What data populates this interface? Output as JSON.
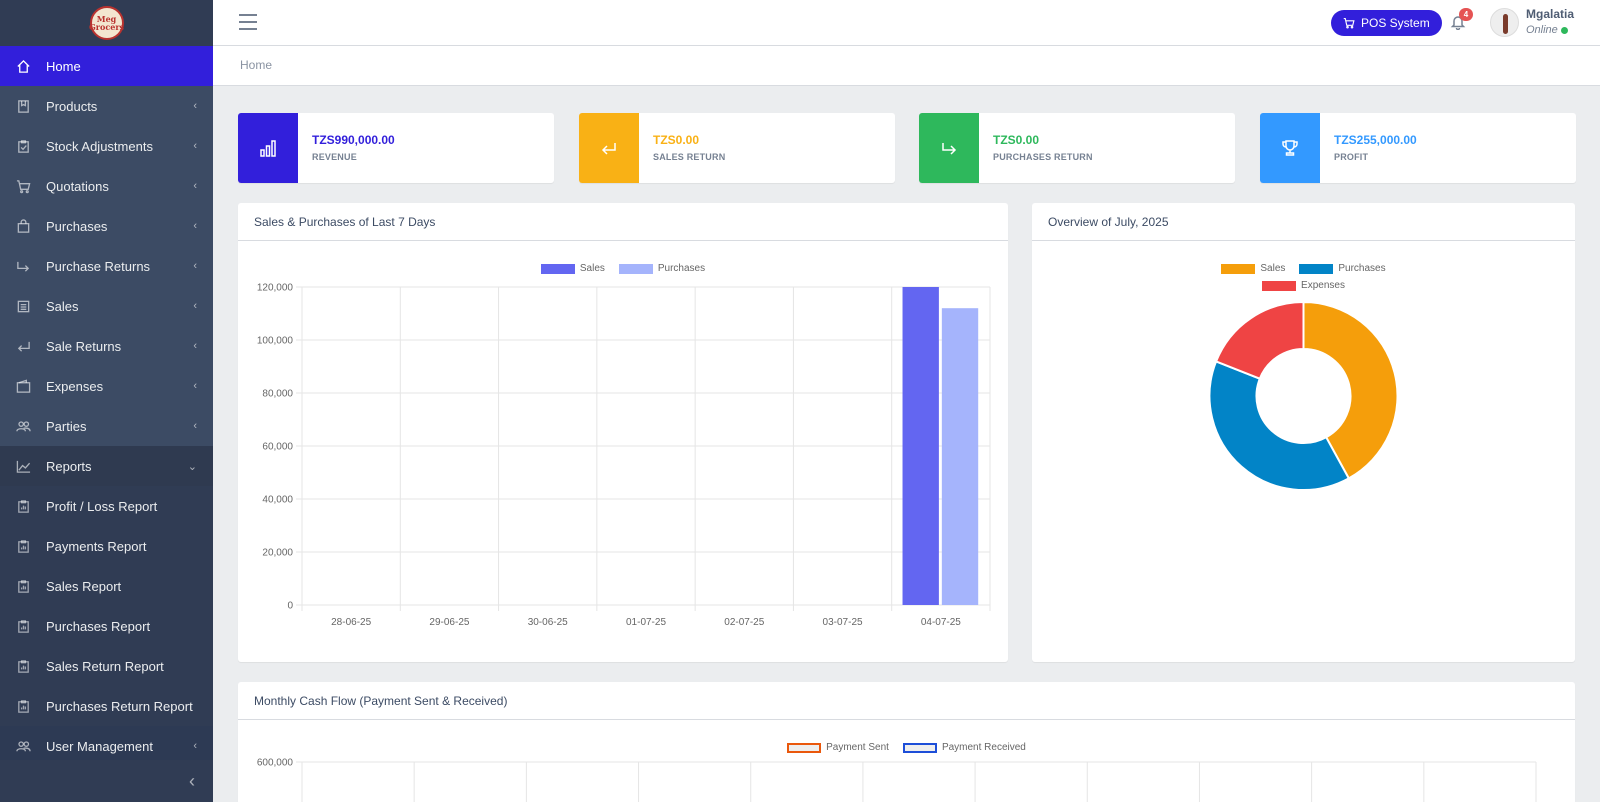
{
  "sidebar": {
    "logo_text": "Meg Grocers",
    "items": [
      {
        "label": "Home",
        "icon": "home-icon"
      },
      {
        "label": "Products",
        "icon": "products-icon"
      },
      {
        "label": "Stock Adjustments",
        "icon": "clipboard-check-icon"
      },
      {
        "label": "Quotations",
        "icon": "cart-icon"
      },
      {
        "label": "Purchases",
        "icon": "bag-icon"
      },
      {
        "label": "Purchase Returns",
        "icon": "arrow-return-right-icon"
      },
      {
        "label": "Sales",
        "icon": "list-icon"
      },
      {
        "label": "Sale Returns",
        "icon": "arrow-return-left-icon"
      },
      {
        "label": "Expenses",
        "icon": "wallet-icon"
      },
      {
        "label": "Parties",
        "icon": "people-icon"
      },
      {
        "label": "Reports",
        "icon": "chart-line-icon"
      }
    ],
    "report_items": [
      {
        "label": "Profit / Loss Report"
      },
      {
        "label": "Payments Report"
      },
      {
        "label": "Sales Report"
      },
      {
        "label": "Purchases Report"
      },
      {
        "label": "Sales Return Report"
      },
      {
        "label": "Purchases Return Report"
      }
    ],
    "user_management": "User Management",
    "toggler": "‹"
  },
  "header": {
    "pos_label": "POS System",
    "notification_count": "4",
    "user_name": "Mgalatia",
    "user_status": "Online"
  },
  "breadcrumb": "Home",
  "stats": [
    {
      "value": "TZS990,000.00",
      "label": "REVENUE",
      "color": "#321fdb"
    },
    {
      "value": "TZS0.00",
      "label": "SALES RETURN",
      "color": "#f9b115"
    },
    {
      "value": "TZS0.00",
      "label": "PURCHASES RETURN",
      "color": "#2eb85c"
    },
    {
      "value": "TZS255,000.00",
      "label": "PROFIT",
      "color": "#3399ff"
    }
  ],
  "bar_card": {
    "title": "Sales & Purchases of Last 7 Days"
  },
  "donut_card": {
    "title": "Overview of July, 2025"
  },
  "cash_card": {
    "title": "Monthly Cash Flow (Payment Sent & Received)"
  },
  "chart_data": [
    {
      "type": "bar",
      "title": "Sales & Purchases of Last 7 Days",
      "categories": [
        "28-06-25",
        "29-06-25",
        "30-06-25",
        "01-07-25",
        "02-07-25",
        "03-07-25",
        "04-07-25"
      ],
      "series": [
        {
          "name": "Sales",
          "color": "#6366f1",
          "values": [
            0,
            0,
            0,
            0,
            0,
            0,
            120000
          ]
        },
        {
          "name": "Purchases",
          "color": "#a5b4fc",
          "values": [
            0,
            0,
            0,
            0,
            0,
            0,
            112000
          ]
        }
      ],
      "ylim": [
        0,
        120000
      ],
      "yticks": [
        "120,000",
        "100,000",
        "80,000",
        "60,000",
        "40,000",
        "20,000",
        "0"
      ],
      "legend": "top",
      "grid": true
    },
    {
      "type": "pie",
      "title": "Overview of July, 2025",
      "donut": true,
      "labels": [
        "Sales",
        "Purchases",
        "Expenses"
      ],
      "colors": [
        "#f59e0b",
        "#0284c7",
        "#ef4444"
      ],
      "values": [
        42,
        39,
        19
      ],
      "legend": "top"
    },
    {
      "type": "line",
      "title": "Monthly Cash Flow (Payment Sent & Received)",
      "series": [
        {
          "name": "Payment Sent",
          "color": "#ea580c"
        },
        {
          "name": "Payment Received",
          "color": "#1d4ed8"
        }
      ],
      "yticks": [
        "600,000"
      ],
      "legend": "top",
      "grid": true
    }
  ]
}
